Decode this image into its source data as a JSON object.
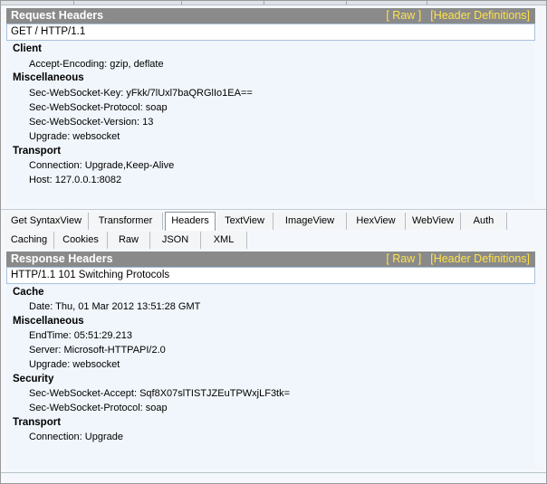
{
  "request": {
    "title": "Request Headers",
    "raw_link": "[ Raw ]",
    "defs_link": "[Header Definitions]",
    "request_line": "GET / HTTP/1.1",
    "groups": [
      {
        "name": "Client",
        "items": [
          "Accept-Encoding: gzip, deflate"
        ]
      },
      {
        "name": "Miscellaneous",
        "items": [
          "Sec-WebSocket-Key: yFkk/7lUxl7baQRGlIo1EA==",
          "Sec-WebSocket-Protocol: soap",
          "Sec-WebSocket-Version: 13",
          "Upgrade: websocket"
        ]
      },
      {
        "name": "Transport",
        "items": [
          "Connection: Upgrade,Keep-Alive",
          "Host: 127.0.0.1:8082"
        ]
      }
    ]
  },
  "tabs": {
    "row1": [
      "Get SyntaxView",
      "Transformer",
      "Headers",
      "TextView",
      "ImageView",
      "HexView",
      "WebView",
      "Auth"
    ],
    "row2": [
      "Caching",
      "Cookies",
      "Raw",
      "JSON",
      "XML"
    ],
    "active": "Headers"
  },
  "response": {
    "title": "Response Headers",
    "raw_link": "[ Raw ]",
    "defs_link": "[Header Definitions]",
    "status_line": "HTTP/1.1 101 Switching Protocols",
    "groups": [
      {
        "name": "Cache",
        "items": [
          "Date: Thu, 01 Mar 2012 13:51:28 GMT"
        ]
      },
      {
        "name": "Miscellaneous",
        "items": [
          "EndTime: 05:51:29.213",
          "Server: Microsoft-HTTPAPI/2.0",
          "Upgrade: websocket"
        ]
      },
      {
        "name": "Security",
        "items": [
          "Sec-WebSocket-Accept: Sqf8X07slTISTJZEuTPWxjLF3tk=",
          "Sec-WebSocket-Protocol: soap"
        ]
      },
      {
        "name": "Transport",
        "items": [
          "Connection: Upgrade"
        ]
      }
    ]
  },
  "colors": {
    "header_bar": "#8a8a8a",
    "link": "#ffe24a",
    "panel_bg": "#f0f6fb"
  }
}
